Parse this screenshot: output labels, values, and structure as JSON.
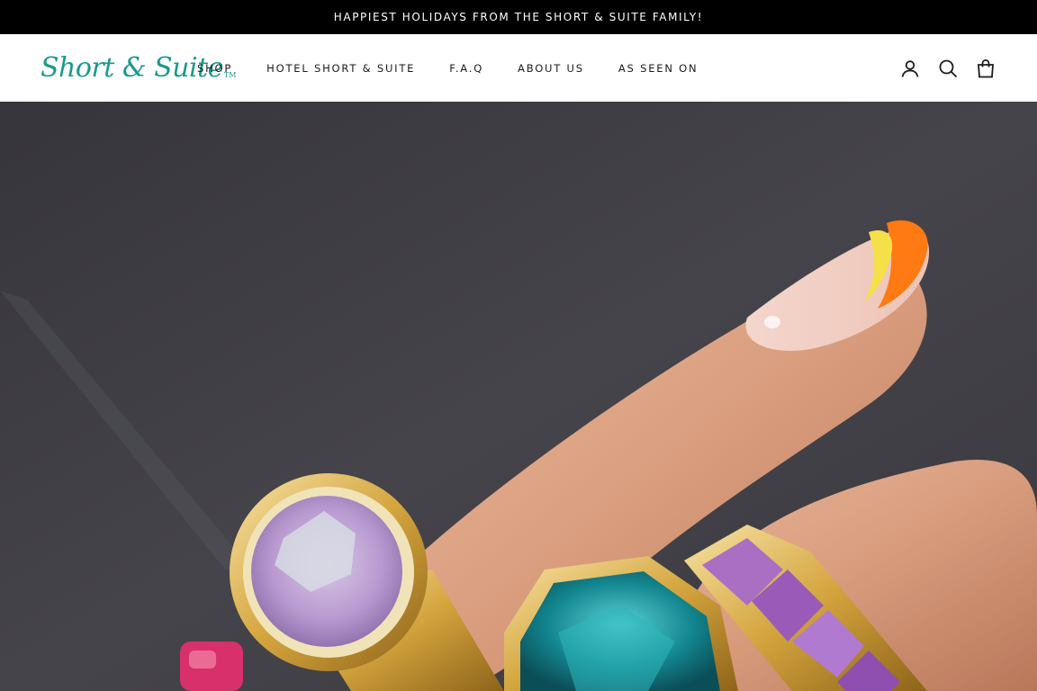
{
  "announcement": {
    "text": "HAPPIEST HOLIDAYS FROM THE SHORT & SUITE FAMILY!"
  },
  "header": {
    "logo": {
      "text": "Short & Suite",
      "trademark": "TM",
      "color": "#1a9a8c"
    },
    "nav": [
      {
        "label": "SHOP"
      },
      {
        "label": "HOTEL SHORT & SUITE"
      },
      {
        "label": "F.A.Q"
      },
      {
        "label": "ABOUT US"
      },
      {
        "label": "AS SEEN ON"
      }
    ],
    "icons": [
      "account-icon",
      "search-icon",
      "cart-icon"
    ]
  },
  "hero": {
    "image": "hand-with-jeweled-rings-photo",
    "background_color": "#3c3b41"
  }
}
